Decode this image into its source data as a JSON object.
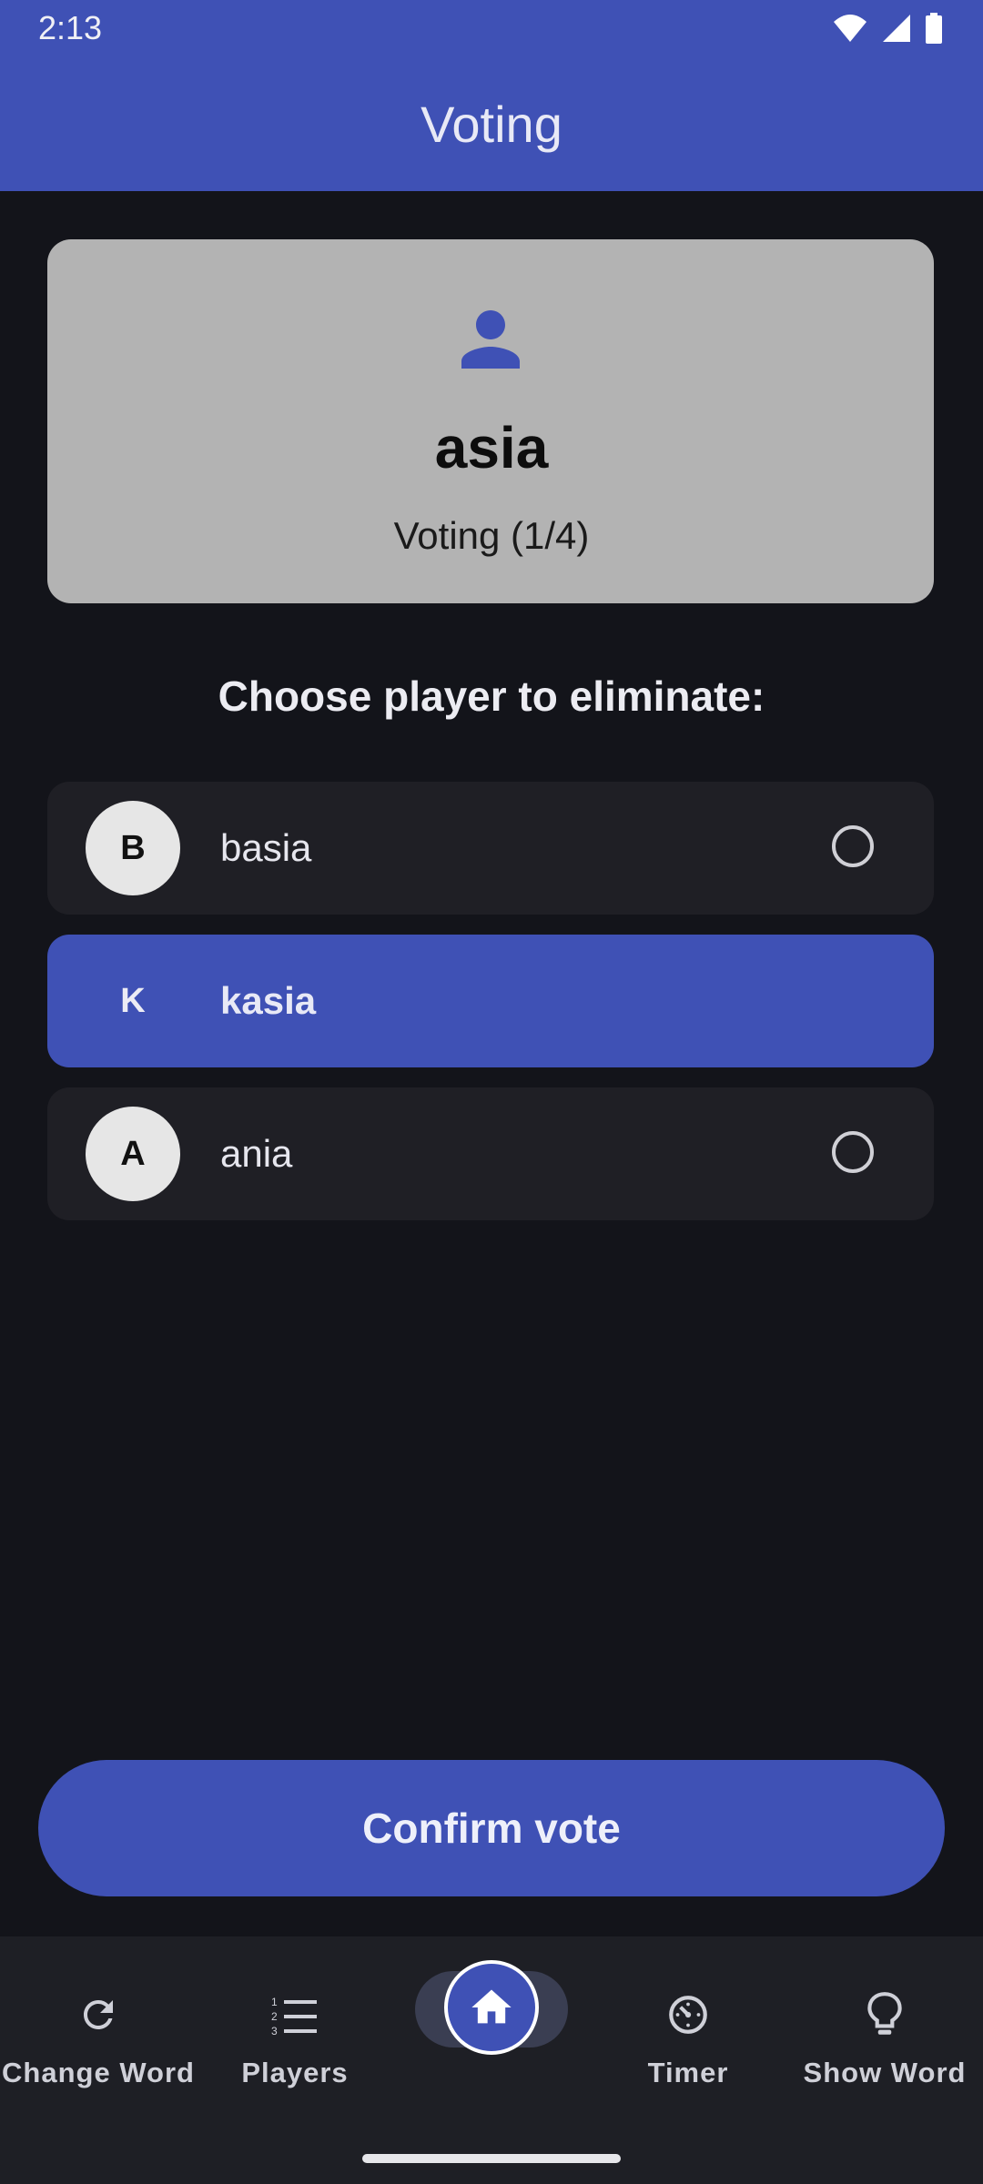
{
  "status_bar": {
    "time": "2:13"
  },
  "app_bar": {
    "title": "Voting"
  },
  "voter_card": {
    "icon": "person-icon",
    "name": "asia",
    "progress": "Voting (1/4)"
  },
  "prompt": "Choose player to eliminate:",
  "players": [
    {
      "initial": "B",
      "name": "basia",
      "selected": false
    },
    {
      "initial": "K",
      "name": "kasia",
      "selected": true
    },
    {
      "initial": "A",
      "name": "ania",
      "selected": false
    }
  ],
  "confirm_button": {
    "label": "Confirm vote"
  },
  "bottom_nav": {
    "items": [
      {
        "label": "Change Word",
        "icon": "refresh-icon"
      },
      {
        "label": "Players",
        "icon": "numbered-list-icon"
      },
      {
        "label": "",
        "icon": "home-icon",
        "active": true
      },
      {
        "label": "Timer",
        "icon": "timer-icon"
      },
      {
        "label": "Show Word",
        "icon": "lightbulb-icon"
      }
    ]
  },
  "colors": {
    "accent": "#3f51b5",
    "background": "#13141a",
    "card": "#b3b3b3",
    "option_bg": "#1f1f25"
  }
}
